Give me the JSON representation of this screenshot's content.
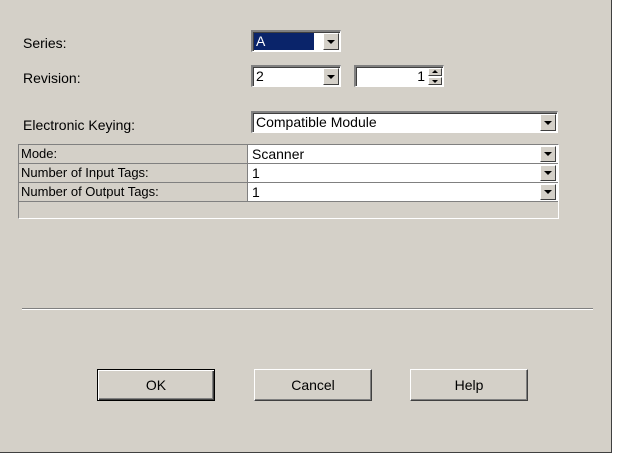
{
  "form": {
    "series": {
      "label": "Series:",
      "value": "A"
    },
    "revision": {
      "label": "Revision:",
      "major": "2",
      "minor": "1"
    },
    "keying": {
      "label": "Electronic Keying:",
      "value": "Compatible Module"
    }
  },
  "grid": {
    "rows": [
      {
        "name": "Mode:",
        "value": "Scanner"
      },
      {
        "name": "Number of Input Tags:",
        "value": "1"
      },
      {
        "name": "Number of Output Tags:",
        "value": "1"
      }
    ]
  },
  "buttons": {
    "ok": "OK",
    "cancel": "Cancel",
    "help": "Help"
  },
  "colors": {
    "face": "#d4d0c8",
    "selection": "#0a246a"
  }
}
